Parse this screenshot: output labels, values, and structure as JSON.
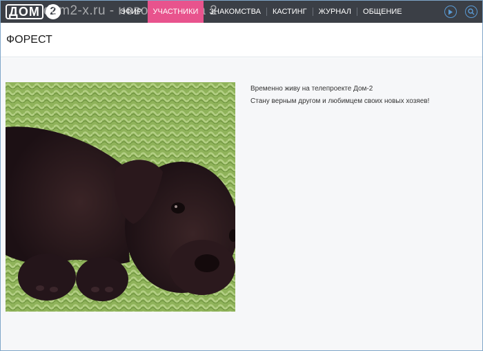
{
  "header": {
    "logo_text": "ДОМ",
    "logo_number": "2",
    "watermark": "dom2-x.ru - новости дома 2",
    "nav": [
      {
        "label": "Эфир",
        "active": false
      },
      {
        "label": "Участники",
        "active": true
      },
      {
        "label": "Знакомства",
        "active": false
      },
      {
        "label": "Кастинг",
        "active": false
      },
      {
        "label": "Журнал",
        "active": false
      },
      {
        "label": "Общение",
        "active": false
      }
    ],
    "icons": [
      "play-icon",
      "search-icon"
    ]
  },
  "page": {
    "title": "ФОРЕСТ"
  },
  "profile": {
    "photo_alt": "puppy-photo",
    "bio_line1": "Временно живу на телепроекте Дом-2",
    "bio_line2": "Стану верным другом и любимцем своих новых хозяев!"
  },
  "colors": {
    "topbar": "#3b3f46",
    "active_tab": "#e8538d",
    "icon_accent": "#5a9bd5",
    "content_bg": "#f6f7f9"
  }
}
